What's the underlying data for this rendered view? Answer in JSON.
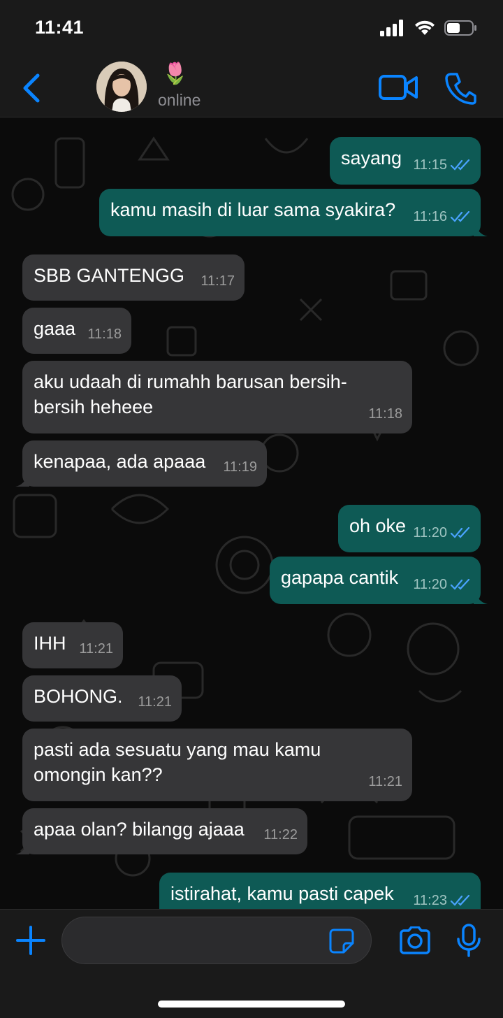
{
  "status_bar": {
    "time": "11:41"
  },
  "header": {
    "contact_name": "🌷",
    "contact_status": "online"
  },
  "messages": [
    {
      "direction": "out",
      "text": "sayang",
      "time": "11:15",
      "read": true
    },
    {
      "direction": "out",
      "text": "kamu masih di luar sama syakira?",
      "time": "11:16",
      "read": true
    },
    {
      "direction": "in",
      "text": "SBB GANTENGG",
      "time": "11:17"
    },
    {
      "direction": "in",
      "text": "gaaa",
      "time": "11:18"
    },
    {
      "direction": "in",
      "text": "aku udaah di rumahh barusan bersih-bersih heheee",
      "time": "11:18"
    },
    {
      "direction": "in",
      "text": "kenapaa, ada apaaa",
      "time": "11:19"
    },
    {
      "direction": "out",
      "text": "oh oke",
      "time": "11:20",
      "read": true
    },
    {
      "direction": "out",
      "text": "gapapa cantik",
      "time": "11:20",
      "read": true
    },
    {
      "direction": "in",
      "text": "IHH",
      "time": "11:21"
    },
    {
      "direction": "in",
      "text": "BOHONG.",
      "time": "11:21"
    },
    {
      "direction": "in",
      "text": "pasti ada sesuatu yang mau kamu omongin kan??",
      "time": "11:21"
    },
    {
      "direction": "in",
      "text": "apaa olan? bilangg ajaaa",
      "time": "11:22"
    },
    {
      "direction": "out",
      "text": "istirahat, kamu pasti capek",
      "time": "11:23",
      "read": true
    }
  ],
  "input": {
    "value": "",
    "placeholder": ""
  },
  "colors": {
    "accent": "#0a84ff",
    "incoming_bubble": "#363638",
    "outgoing_bubble": "#0e5a55",
    "read_tick": "#4aa3ff"
  },
  "icons": {
    "back": "chevron-left-icon",
    "video": "video-camera-icon",
    "call": "phone-icon",
    "add": "plus-icon",
    "sticker": "sticker-icon",
    "camera": "camera-icon",
    "mic": "microphone-icon"
  }
}
